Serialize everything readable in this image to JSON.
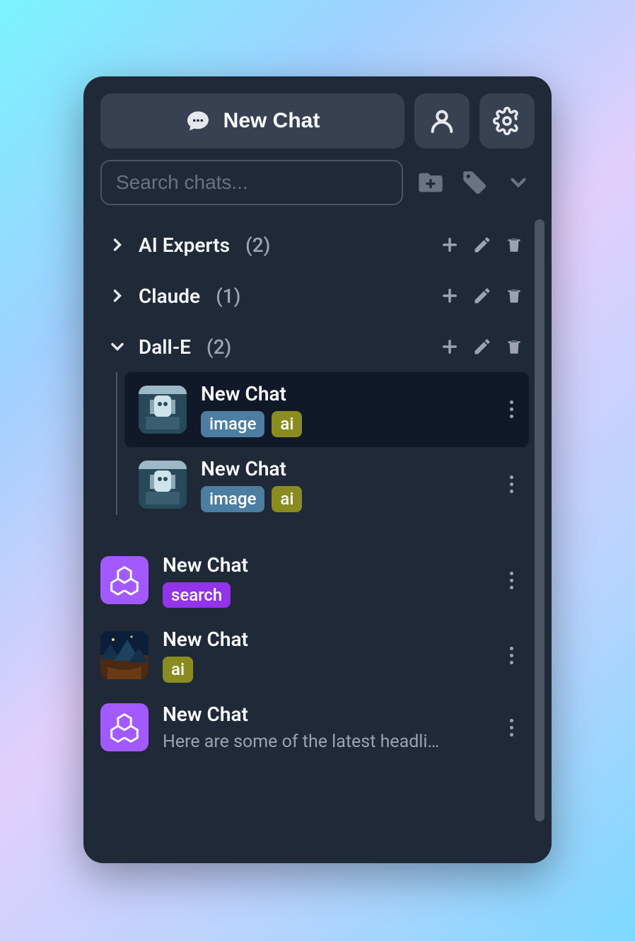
{
  "header": {
    "new_chat_label": "New Chat"
  },
  "search": {
    "placeholder": "Search chats..."
  },
  "folders": [
    {
      "name": "AI Experts",
      "count": "(2)",
      "expanded": false
    },
    {
      "name": "Claude",
      "count": "(1)",
      "expanded": false
    },
    {
      "name": "Dall-E",
      "count": "(2)",
      "expanded": true,
      "chats": [
        {
          "title": "New Chat",
          "tags": [
            {
              "label": "image",
              "cls": "tag-blue"
            },
            {
              "label": "ai",
              "cls": "tag-olive"
            }
          ],
          "avatar": "robot",
          "selected": true
        },
        {
          "title": "New Chat",
          "tags": [
            {
              "label": "image",
              "cls": "tag-blue"
            },
            {
              "label": "ai",
              "cls": "tag-olive"
            }
          ],
          "avatar": "robot",
          "selected": false
        }
      ]
    }
  ],
  "root_chats": [
    {
      "title": "New Chat",
      "tags": [
        {
          "label": "search",
          "cls": "tag-purple"
        }
      ],
      "avatar": "openai"
    },
    {
      "title": "New Chat",
      "tags": [
        {
          "label": "ai",
          "cls": "tag-olive"
        }
      ],
      "avatar": "fantasy"
    },
    {
      "title": "New Chat",
      "subtitle": "Here are some of the latest headli…",
      "avatar": "openai"
    }
  ]
}
